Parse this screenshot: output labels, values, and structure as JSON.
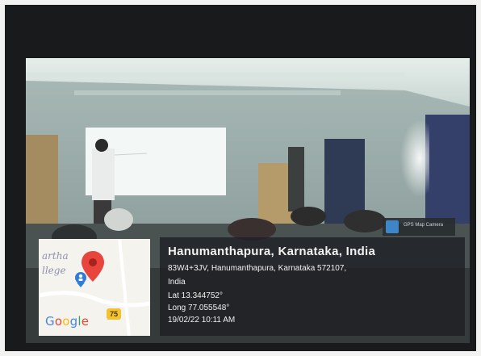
{
  "map": {
    "text_line1": "artha",
    "text_line2": "llege",
    "logo_letters": [
      "G",
      "o",
      "o",
      "g",
      "l",
      "e"
    ],
    "road_number": "75",
    "icons": [
      "location-pin-icon",
      "person-pin-icon"
    ]
  },
  "location": {
    "title": "Hanumanthapura, Karnataka, India",
    "address_line1": "83W4+3JV, Hanumanthapura, Karnataka 572107,",
    "address_line2": "India",
    "latitude": "Lat 13.344752°",
    "longitude": "Long 77.055548°",
    "timestamp": "19/02/22 10:11 AM"
  },
  "app_badge": {
    "label": "GPS Map Camera"
  },
  "colors": {
    "frame": "#191a1c",
    "overlay": "#1e2024",
    "pin": "#e8453c"
  }
}
